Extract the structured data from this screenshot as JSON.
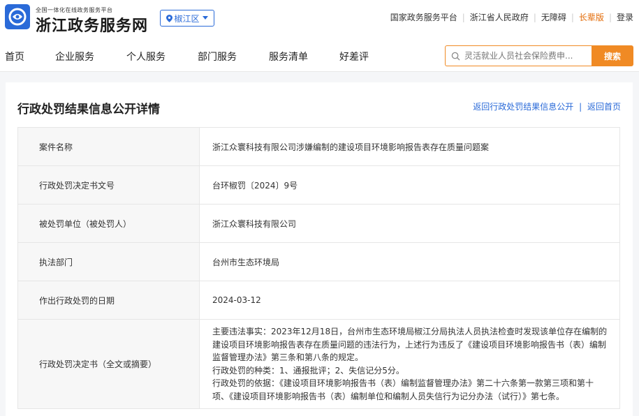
{
  "header": {
    "logo_subtitle": "全国一体化在线政务服务平台",
    "logo_title": "浙江政务服务网",
    "region": "椒江区",
    "top_links": [
      {
        "label": "国家政务服务平台"
      },
      {
        "label": "浙江省人民政府"
      },
      {
        "label": "无障碍"
      },
      {
        "label": "长辈版"
      },
      {
        "label": "登录"
      }
    ]
  },
  "nav": {
    "items": [
      {
        "label": "首页"
      },
      {
        "label": "企业服务"
      },
      {
        "label": "个人服务"
      },
      {
        "label": "部门服务"
      },
      {
        "label": "服务清单"
      },
      {
        "label": "好差评"
      }
    ],
    "search_placeholder": "灵活就业人员社会保险费申...",
    "search_button": "搜索"
  },
  "page": {
    "title": "行政处罚结果信息公开详情",
    "back_link": "返回行政处罚结果信息公开",
    "home_link": "返回首页"
  },
  "details": [
    {
      "label": "案件名称",
      "value": "浙江众寰科技有限公司涉嫌编制的建设项目环境影响报告表存在质量问题案"
    },
    {
      "label": "行政处罚决定书文号",
      "value": "台环椒罚〔2024〕9号"
    },
    {
      "label": "被处罚单位（被处罚人）",
      "value": "浙江众寰科技有限公司"
    },
    {
      "label": "执法部门",
      "value": "台州市生态环境局"
    },
    {
      "label": "作出行政处罚的日期",
      "value": "2024-03-12"
    }
  ],
  "decision": {
    "label": "行政处罚决定书（全文或摘要）",
    "lines": [
      "主要违法事实：2023年12月18日，台州市生态环境局椒江分局执法人员执法检查时发现该单位存在编制的",
      "建设项目环境影响报告表存在质量问题的违法行为，上述行为违反了《建设项目环境影响报告书（表）编制",
      "监督管理办法》第三条和第八条的规定。",
      "行政处罚的种类：1、通报批评；2、失信记分5分。",
      "行政处罚的依据：《建设项目环境影响报告书（表）编制监督管理办法》第二十六条第一款第三项和第十",
      "项、《建设项目环境影响报告书（表）编制单位和编制人员失信行为记分办法（试行）》第七条。"
    ]
  },
  "colors": {
    "brand_blue": "#2a6ad8",
    "accent_orange": "#f08a24",
    "elder_link": "#e36c09"
  }
}
